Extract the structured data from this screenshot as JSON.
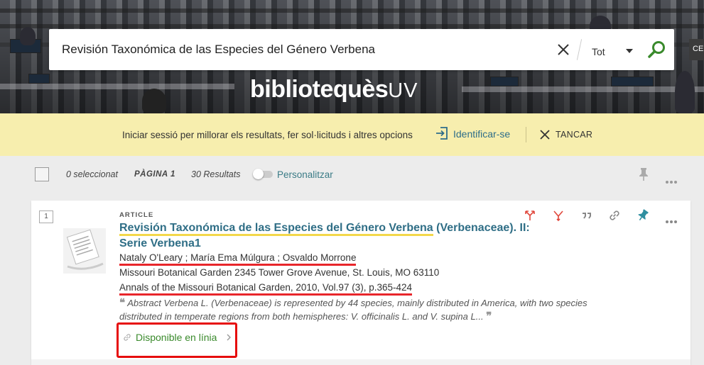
{
  "search": {
    "query": "Revisión Taxonómica de las Especies del Género Verbena",
    "scope": "Tot",
    "side_tab": "CE"
  },
  "logo": {
    "main": "bibliotequès",
    "suffix": "UV"
  },
  "login_bar": {
    "message": "Iniciar sessió per millorar els resultats, fer sol·licituds i altres opcions",
    "signin_label": "Identificar-se",
    "close_label": "TANCAR"
  },
  "toolbar": {
    "selected": "0 seleccionat",
    "page": "PÀGINA 1",
    "results": "30 Resultats",
    "personalize": "Personalitzar"
  },
  "result": {
    "number": "1",
    "type": "ARTICLE",
    "title_highlight": "Revisión Taxonómica de las Especies del Género Verbena",
    "title_rest": " (Verbenaceae). II: Serie Verbena1",
    "authors": "Nataly O'Leary ; María Ema Múlgura ; Osvaldo Morrone",
    "publisher": "Missouri Botanical Garden 2345 Tower Grove Avenue, St. Louis, MO 63110",
    "source": "Annals of the Missouri Botanical Garden, 2010, Vol.97 (3), p.365-424",
    "abstract": "Abstract Verbena L. (Verbenaceae) is represented by 44 species, mainly distributed in America, with two species distributed in temperate regions from both hemispheres: V. officinalis L. and V. supina L...",
    "availability": "Disponible en línia"
  },
  "colors": {
    "accent": "#2f6e86",
    "available": "#3a8a2c",
    "login_bg": "#f7eeae",
    "highlight": "#f3d84a",
    "annotation_red": "#e8262b"
  },
  "icons": [
    "clear-icon",
    "chevron-down-icon",
    "search-icon",
    "sign-in-icon",
    "close-icon",
    "pin-icon",
    "more-icon",
    "share-icon",
    "cite-icon",
    "link-icon",
    "chevron-right-icon"
  ]
}
